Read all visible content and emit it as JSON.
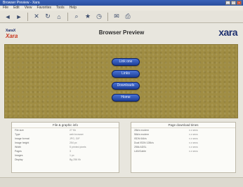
{
  "window": {
    "title": "Browser Preview - Xara",
    "min": "_",
    "max": "□",
    "close": "x"
  },
  "menu": [
    "File",
    "Edit",
    "View",
    "Favorites",
    "Tools",
    "Help"
  ],
  "toolbar": {
    "icons": [
      "back-icon",
      "forward-icon",
      "stop-icon",
      "refresh-icon",
      "home-icon",
      "search-icon",
      "favorites-icon",
      "history-icon",
      "mail-icon",
      "print-icon"
    ]
  },
  "page": {
    "logo_left_line1": "XaraX",
    "logo_left_line2": "Xara",
    "title": "Browser Preview",
    "logo_right": "xara"
  },
  "nav": {
    "buttons": [
      "Link one",
      "Links",
      "Downloads",
      "Home"
    ]
  },
  "info_left": {
    "title": "File & graphic info",
    "rows": [
      {
        "k": "File size",
        "v": "27 Kb"
      },
      {
        "k": "Type",
        "v": "web browser"
      },
      {
        "k": "Image format",
        "v": "JPG, GIF"
      },
      {
        "k": "Image height",
        "v": "254 px"
      },
      {
        "k": "Width",
        "v": "5 printed pixels"
      },
      {
        "k": "Pages",
        "v": "3"
      },
      {
        "k": "Images",
        "v": "1 px"
      },
      {
        "k": "Display",
        "v": "Bg 256 Kb"
      }
    ]
  },
  "info_right": {
    "title": "Page download times",
    "rows": [
      {
        "k": "28k/s modem",
        "v": "x.x secs"
      },
      {
        "k": "56k/s modem",
        "v": "x.x secs"
      },
      {
        "k": "ISDN 64k/s",
        "v": "x.x secs"
      },
      {
        "k": "Dual ISDN 128k/s",
        "v": "x.x secs"
      },
      {
        "k": "256k ADSL",
        "v": "x.x secs"
      },
      {
        "k": "LAN/Cable",
        "v": "x.x secs"
      }
    ]
  }
}
